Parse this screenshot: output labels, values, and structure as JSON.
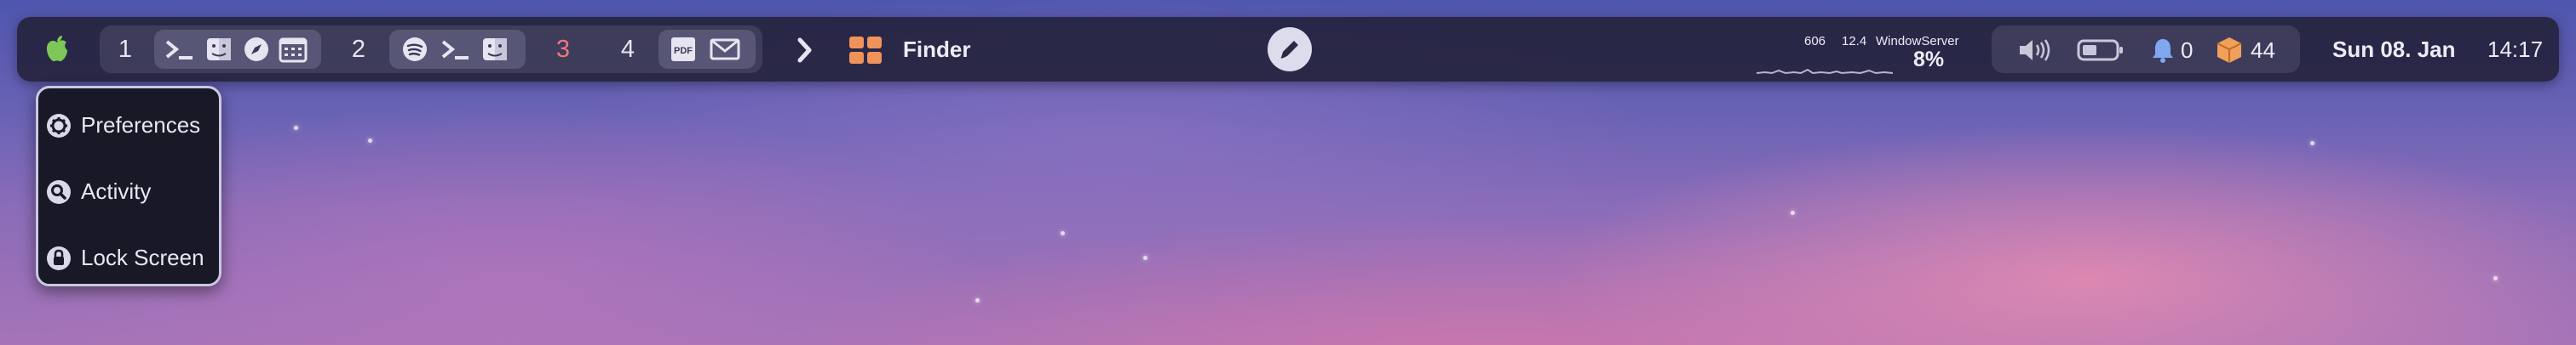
{
  "bar": {
    "spaces": [
      {
        "label": "1",
        "apps": [
          "terminal-icon",
          "finder-icon",
          "safari-icon",
          "calendar-icon"
        ]
      },
      {
        "label": "2",
        "apps": [
          "spotify-icon",
          "terminal-icon",
          "finder-icon"
        ]
      },
      {
        "label": "3",
        "apps": [],
        "color": "#f0777a"
      },
      {
        "label": "4",
        "apps": [
          "pdf-icon",
          "mail-icon"
        ]
      }
    ],
    "front_app": "Finder",
    "top_process": {
      "pid": "606",
      "cpu": "12.4",
      "name": "WindowServer"
    },
    "cpu_percent": "8%",
    "notifications": "0",
    "packages": "44",
    "date": "Sun 08. Jan",
    "time": "14:17"
  },
  "menu": {
    "items": [
      {
        "label": "Preferences",
        "icon": "gear-icon"
      },
      {
        "label": "Activity",
        "icon": "magnifier-icon"
      },
      {
        "label": "Lock Screen",
        "icon": "lock-icon"
      }
    ]
  },
  "colors": {
    "bar_bg": "#26243e",
    "space_active": "#f0777a",
    "finder_orange": "#f0935a",
    "apple_green": "#7dc858"
  }
}
